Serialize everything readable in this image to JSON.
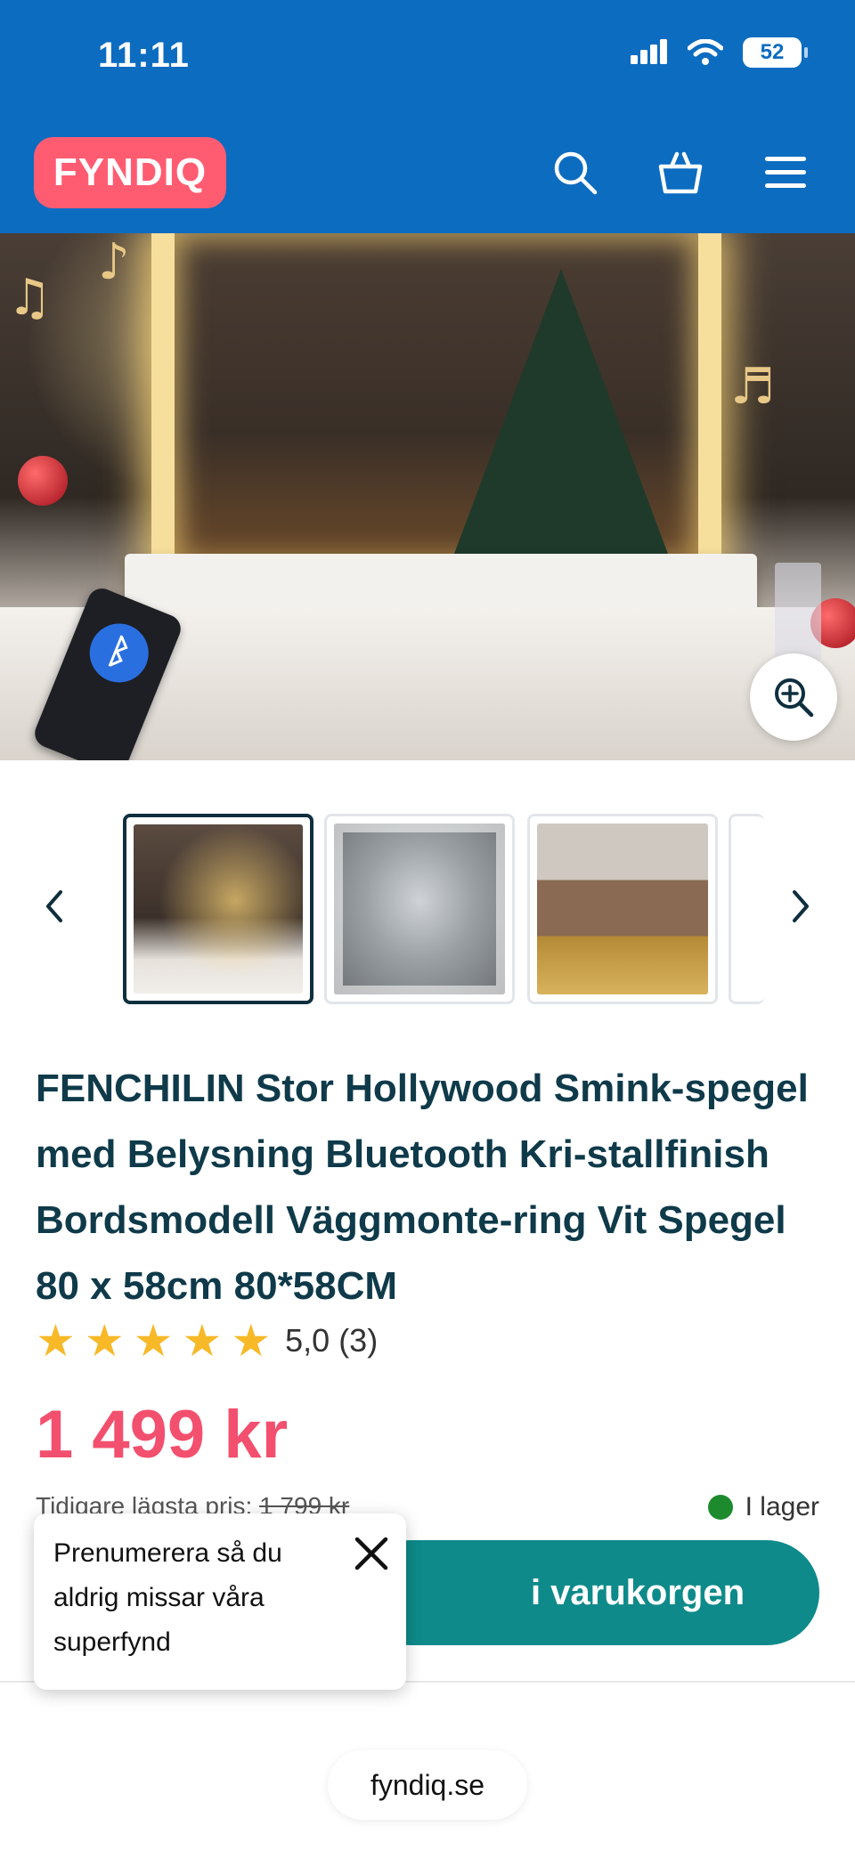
{
  "status_bar": {
    "time": "11:11",
    "battery": "52"
  },
  "header": {
    "logo_text": "FYNDIQ",
    "icons": [
      "search-icon",
      "cart-icon",
      "menu-icon"
    ],
    "background_color": "#0c6cc0",
    "logo_color": "#ff5c72"
  },
  "gallery": {
    "thumbnails": 3,
    "active_index": 0
  },
  "product": {
    "title": "FENCHILIN Stor Hollywood Smink-spegel med Belysning Bluetooth Kri-stallfinish Bordsmodell Väggmonte-ring Vit Spegel 80 x 58cm 80*58CM",
    "rating_value": 5,
    "rating_text": "5,0",
    "rating_count": "(3)",
    "price": "1 499 kr",
    "previous_label": "Tidigare lägsta pris:",
    "previous_price": "1 799 kr",
    "stock": "I lager",
    "add_to_cart_visible": "i varukorgen"
  },
  "popup": {
    "text": "Prenumerera så du aldrig missar våra superfynd"
  },
  "footer": {
    "url": "fyndiq.se"
  },
  "colors": {
    "price": "#f2506e",
    "cart_button": "#0e8a8a",
    "stock_dot": "#1e8a2e",
    "star": "#f7b928"
  }
}
